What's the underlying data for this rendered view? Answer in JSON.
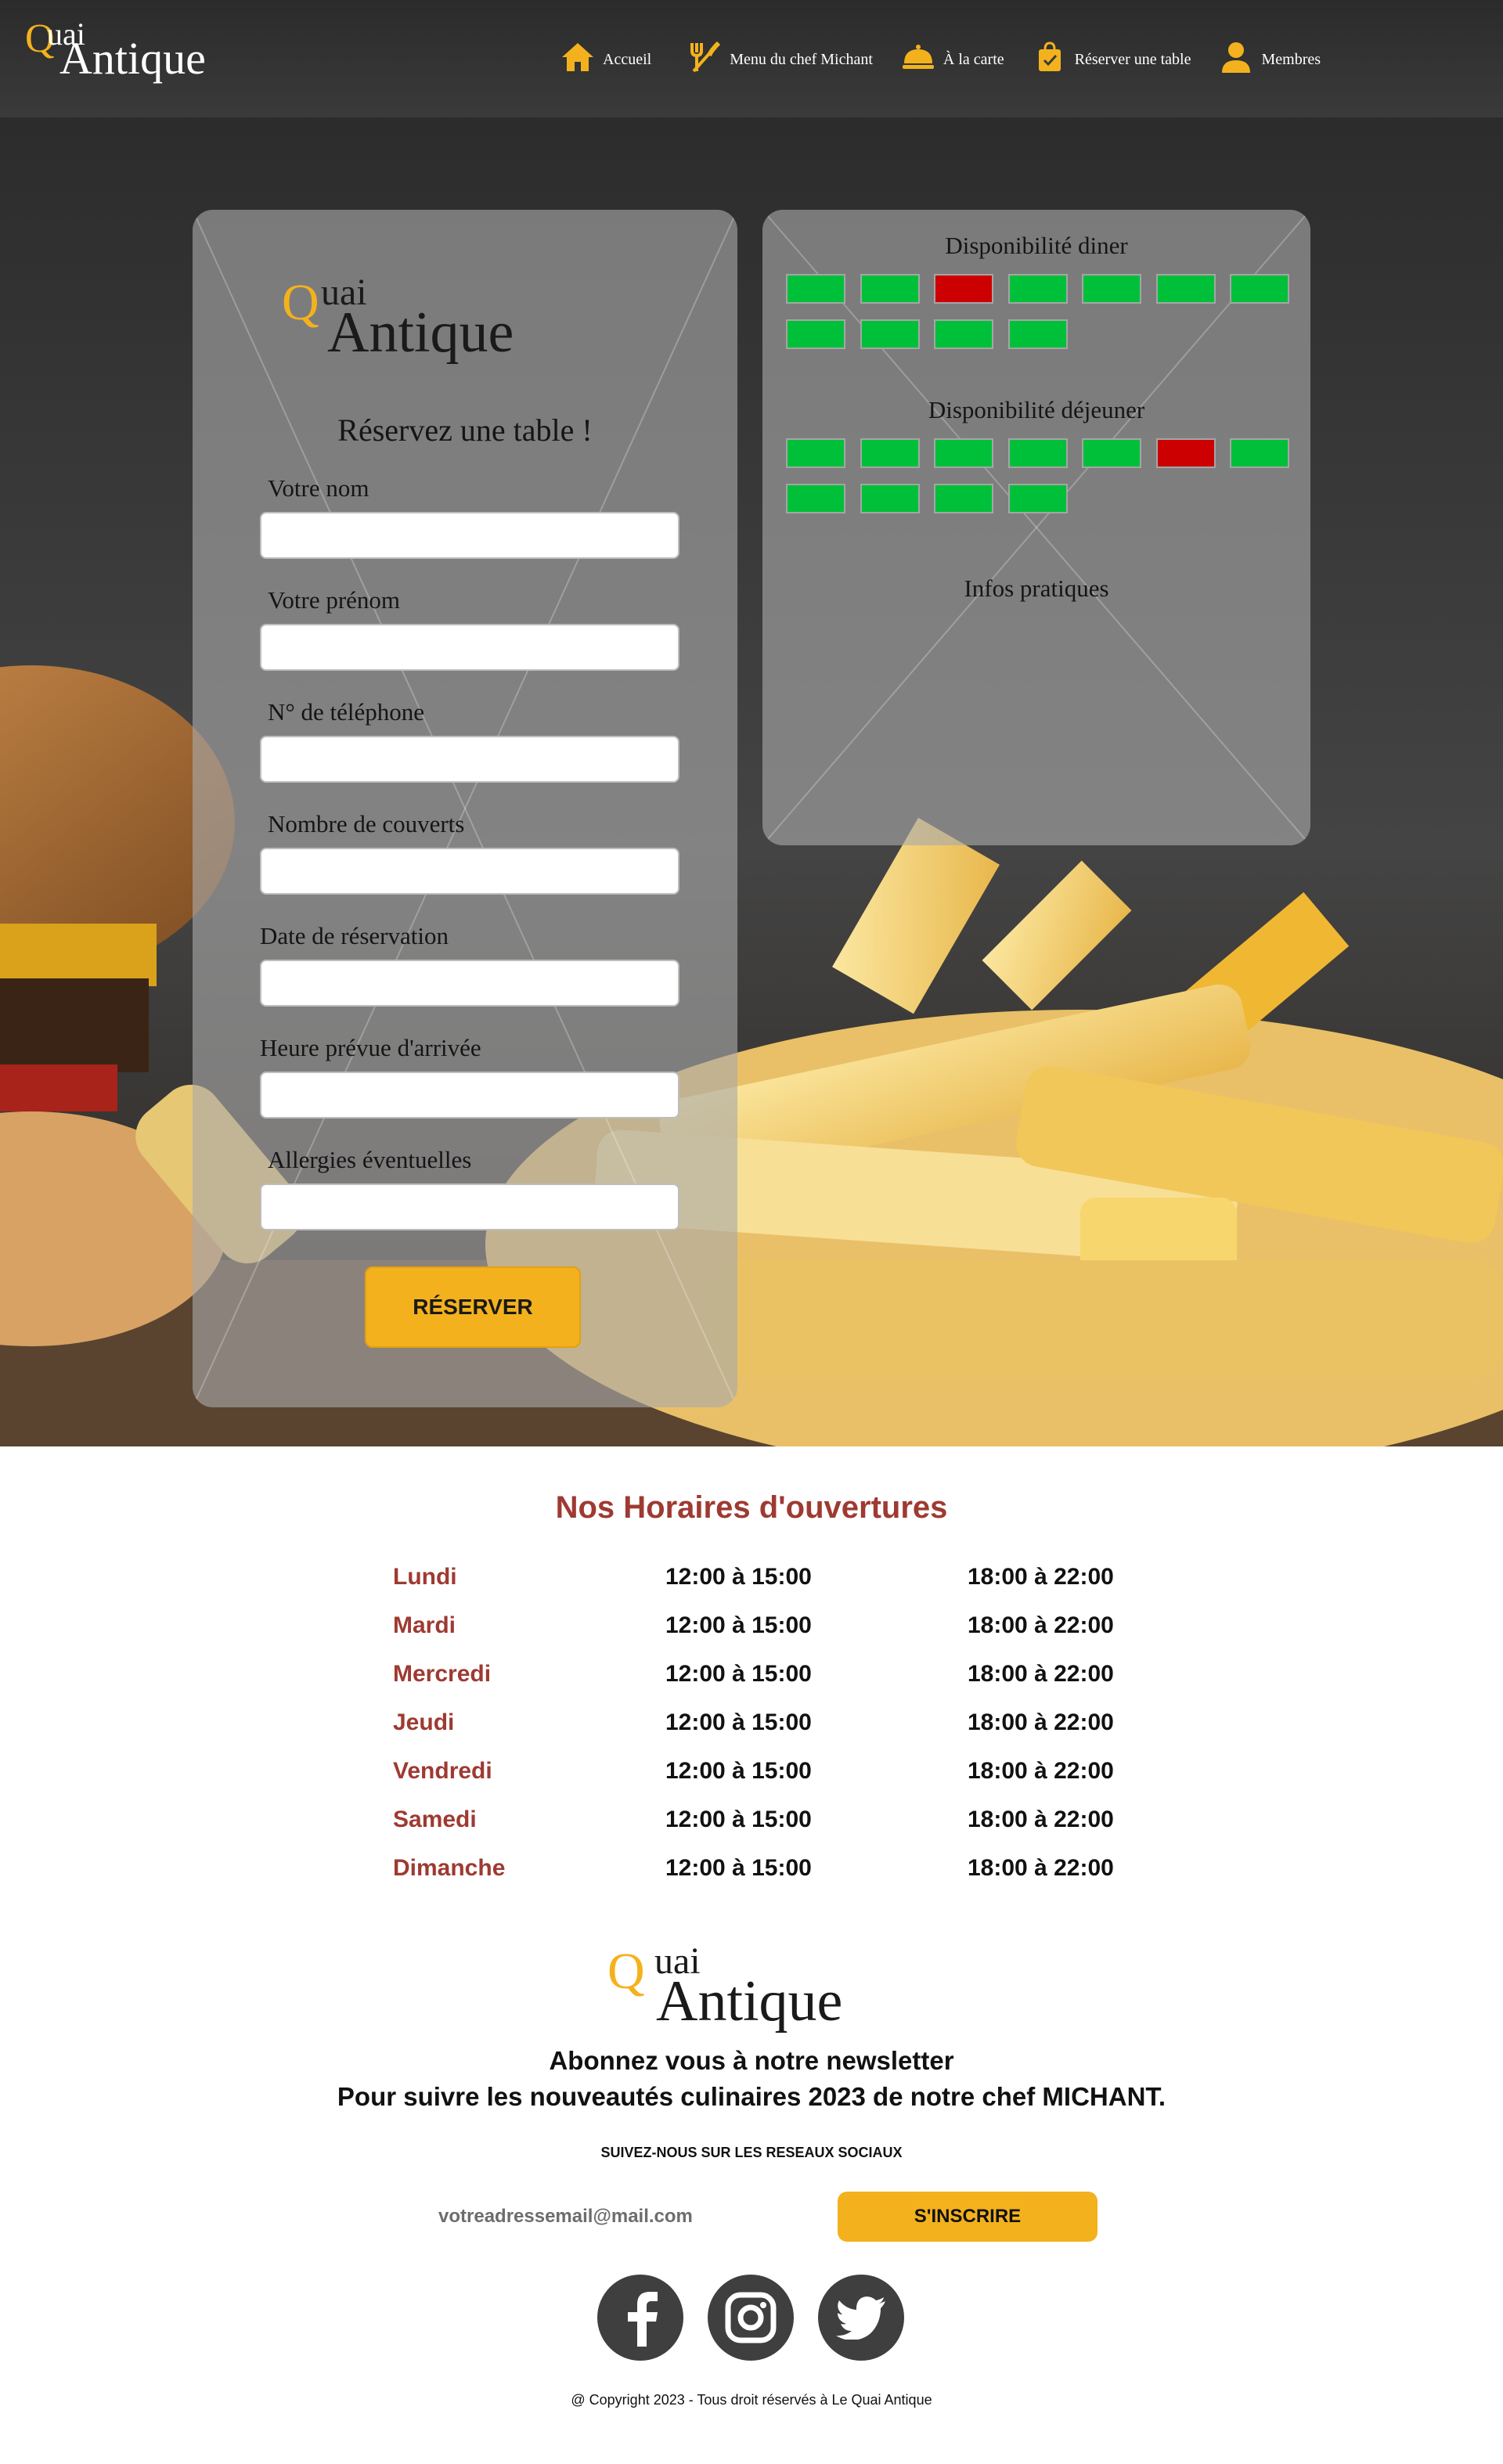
{
  "brand": {
    "q": "Q",
    "uai": "uai",
    "antique": "Antique"
  },
  "nav": [
    {
      "label": "Accueil",
      "icon": "home-icon"
    },
    {
      "label": "Menu du chef Michant",
      "icon": "utensils-icon"
    },
    {
      "label": "À la carte",
      "icon": "cloche-icon"
    },
    {
      "label": "Réserver une table",
      "icon": "booking-bag-icon"
    },
    {
      "label": "Membres",
      "icon": "user-icon"
    }
  ],
  "reservation": {
    "title": "Réservez une table !",
    "fields": [
      {
        "label": "Votre nom",
        "value": ""
      },
      {
        "label": "Votre prénom",
        "value": ""
      },
      {
        "label": "N° de téléphone",
        "value": ""
      },
      {
        "label": "Nombre de couverts",
        "value": ""
      },
      {
        "label": "Date de réservation",
        "value": ""
      },
      {
        "label": "Heure prévue d'arrivée",
        "value": ""
      },
      {
        "label": "Allergies éventuelles",
        "value": ""
      }
    ],
    "submit_label": "RÉSERVER"
  },
  "availability": {
    "diner_title": "Disponibilité diner",
    "diner_slots": [
      "available",
      "available",
      "full",
      "available",
      "available",
      "available",
      "available",
      "available",
      "available",
      "available",
      "available"
    ],
    "dejeuner_title": "Disponibilité déjeuner",
    "dejeuner_slots": [
      "available",
      "available",
      "available",
      "available",
      "available",
      "full",
      "available",
      "available",
      "available",
      "available",
      "available"
    ],
    "infos_title": "Infos pratiques"
  },
  "colors": {
    "accent": "#f3b21d",
    "available": "#00c03a",
    "full": "#cc0000",
    "hours_title": "#9e3a32"
  },
  "hours": {
    "title": "Nos Horaires d'ouvertures",
    "rows": [
      {
        "day": "Lundi",
        "lunch": "12:00 à 15:00",
        "dinner": "18:00 à 22:00"
      },
      {
        "day": "Mardi",
        "lunch": "12:00 à 15:00",
        "dinner": "18:00 à 22:00"
      },
      {
        "day": "Mercredi",
        "lunch": "12:00 à 15:00",
        "dinner": "18:00 à 22:00"
      },
      {
        "day": "Jeudi",
        "lunch": "12:00 à 15:00",
        "dinner": "18:00 à 22:00"
      },
      {
        "day": "Vendredi",
        "lunch": "12:00 à 15:00",
        "dinner": "18:00 à 22:00"
      },
      {
        "day": "Samedi",
        "lunch": "12:00 à 15:00",
        "dinner": "18:00 à 22:00"
      },
      {
        "day": "Dimanche",
        "lunch": "12:00 à 15:00",
        "dinner": "18:00 à 22:00"
      }
    ]
  },
  "footer": {
    "newsletter_line1": "Abonnez vous à notre newsletter",
    "newsletter_line2": "Pour suivre les nouveautés culinaires 2023 de notre chef MICHANT.",
    "follow": "SUIVEZ-NOUS SUR LES RESEAUX SOCIAUX",
    "email_placeholder": "votreadressemail@mail.com",
    "subscribe_label": "S'INSCRIRE",
    "socials": [
      "facebook-icon",
      "instagram-icon",
      "twitter-icon"
    ],
    "copyright": "@ Copyright 2023 - Tous droit réservés à  Le Quai Antique"
  }
}
